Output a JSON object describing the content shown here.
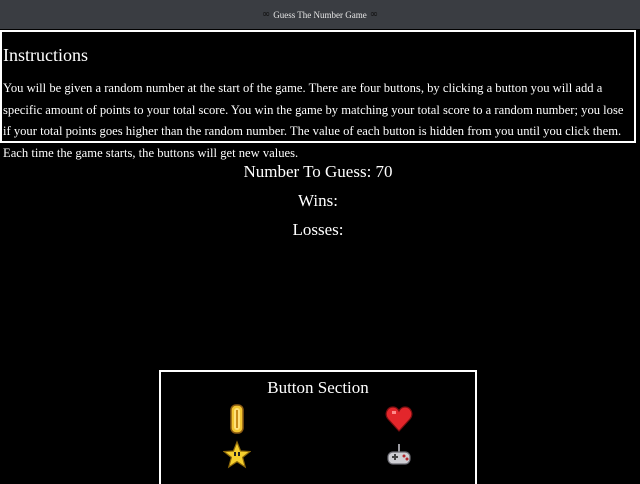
{
  "titlebar": {
    "left_icon": "infinity-glyph",
    "title": "Guess The Number Game",
    "right_icon": "infinity-glyph"
  },
  "instructions": {
    "heading": "Instructions",
    "body": "You will be given a random number at the start of the game. There are four buttons, by clicking a button you will add a specific amount of points to your total score. You win the game by matching your total score to a random number; you lose if your total points goes higher than the random number. The value of each button is hidden from you until you click them. Each time the game starts, the buttons will get new values."
  },
  "stats": {
    "number_to_guess_label": "Number To Guess: 70",
    "wins_label": "Wins:",
    "losses_label": "Losses:"
  },
  "button_section": {
    "heading": "Button Section",
    "buttons": [
      {
        "icon": "coin-icon"
      },
      {
        "icon": "heart-icon"
      },
      {
        "icon": "star-icon"
      },
      {
        "icon": "gamepad-icon"
      }
    ]
  },
  "colors": {
    "background": "#000000",
    "titlebar": "#3a3d42",
    "text": "#ffffff",
    "coin": "#f2c531",
    "heart": "#e3262b",
    "star": "#f5cf2d",
    "gamepad": "#cfcfd4"
  }
}
